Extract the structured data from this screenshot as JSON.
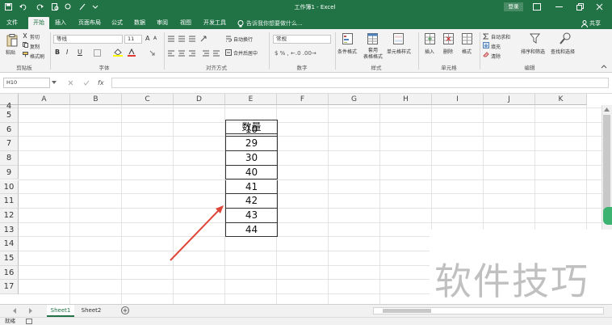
{
  "window": {
    "title": "工作簿1 - Excel",
    "login_label": "登录"
  },
  "tabs": [
    {
      "label": "文件",
      "active": false
    },
    {
      "label": "开始",
      "active": true
    },
    {
      "label": "插入",
      "active": false
    },
    {
      "label": "页面布局",
      "active": false
    },
    {
      "label": "公式",
      "active": false
    },
    {
      "label": "数据",
      "active": false
    },
    {
      "label": "审阅",
      "active": false
    },
    {
      "label": "视图",
      "active": false
    },
    {
      "label": "开发工具",
      "active": false
    }
  ],
  "tell_me": "告诉我你想要做什么...",
  "share_label": "共享",
  "ribbon": {
    "clipboard": {
      "paste": "粘贴",
      "cut": "剪切",
      "copy": "复制",
      "format_painter": "格式刷",
      "group": "剪贴板"
    },
    "font": {
      "name": "等线",
      "size": "11",
      "bold": "B",
      "italic": "I",
      "underline": "U",
      "grow": "A",
      "shrink": "A",
      "group": "字体"
    },
    "alignment": {
      "wrap": "自动换行",
      "merge": "合并后居中",
      "group": "对齐方式"
    },
    "number": {
      "format": "常规",
      "group": "数字"
    },
    "styles": {
      "conditional": "条件格式",
      "table": "套用\n表格格式",
      "cell_styles": "单元格样式",
      "group": "样式"
    },
    "cells": {
      "insert": "插入",
      "delete": "删除",
      "format": "格式",
      "group": "单元格"
    },
    "editing": {
      "autosum": "自动求和",
      "fill": "填充",
      "clear": "清除",
      "sort": "排序和筛选",
      "find": "查找和选择",
      "group": "编辑"
    }
  },
  "formula_bar": {
    "name_box": "H10",
    "fx": "fx",
    "value": ""
  },
  "columns": [
    "A",
    "B",
    "C",
    "D",
    "E",
    "F",
    "G",
    "H",
    "I",
    "J",
    "K"
  ],
  "rows": [
    "4",
    "5",
    "6",
    "7",
    "8",
    "9",
    "10",
    "11",
    "12",
    "13",
    "14",
    "15",
    "16",
    "17"
  ],
  "table": {
    "header": "数量",
    "values": [
      "10",
      "29",
      "30",
      "40",
      "41",
      "42",
      "43",
      "44"
    ]
  },
  "sheets": [
    {
      "label": "Sheet1",
      "active": true
    },
    {
      "label": "Sheet2",
      "active": false
    }
  ],
  "status": {
    "ready": "就绪"
  },
  "watermark": "软件技巧",
  "colors": {
    "brand": "#217346",
    "arrow": "#e0453a"
  }
}
